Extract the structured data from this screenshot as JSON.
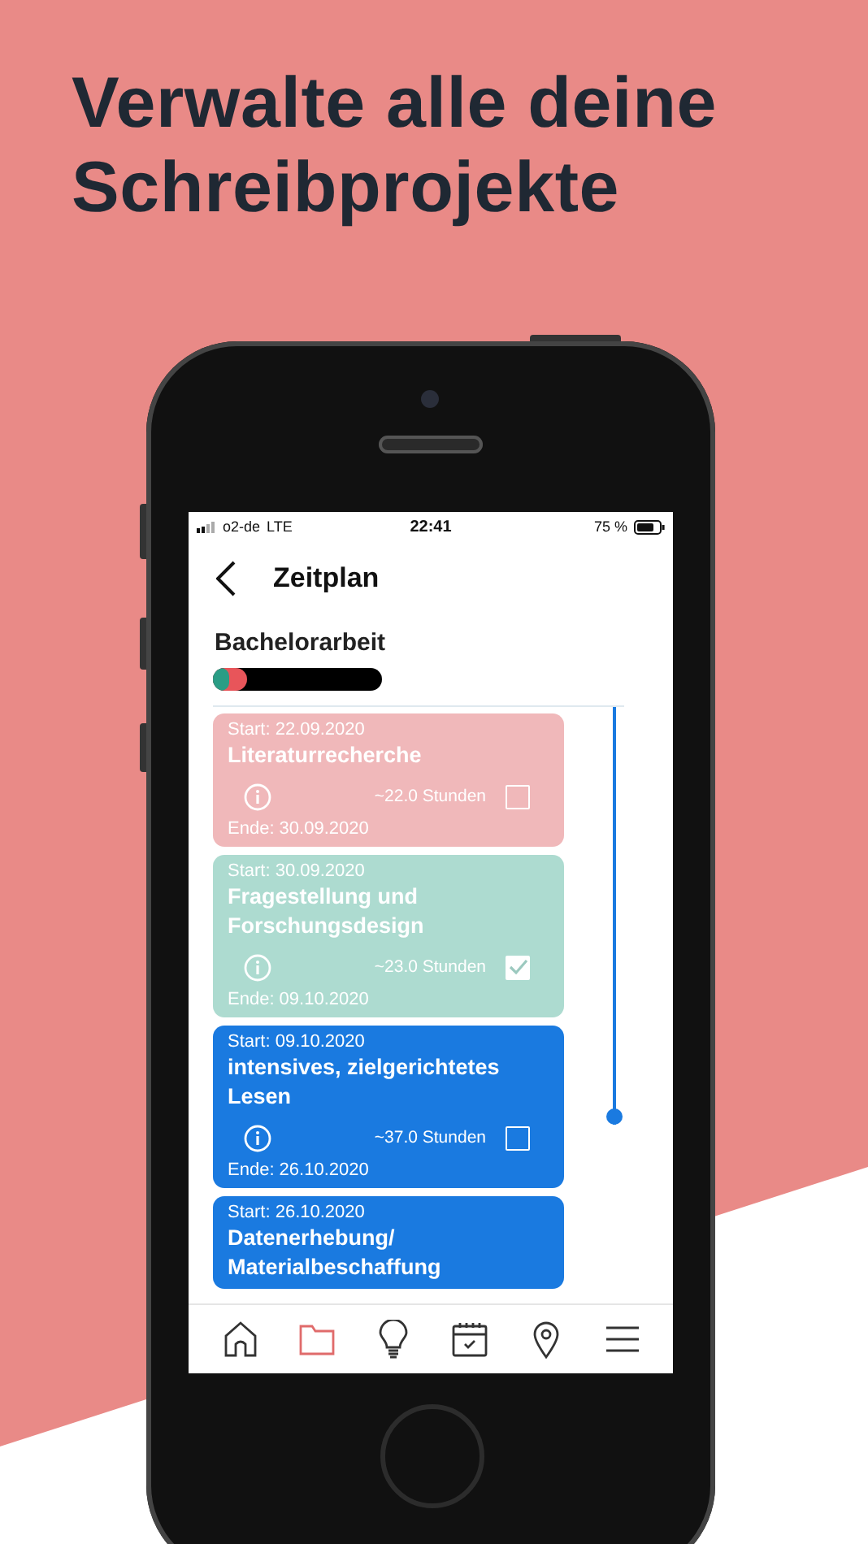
{
  "headline": "Verwalte alle deine Schreibprojekte",
  "status_bar": {
    "carrier": "o2-de",
    "network": "LTE",
    "time": "22:41",
    "battery": "75 %"
  },
  "header": {
    "title": "Zeitplan"
  },
  "project": {
    "name": "Bachelorarbeit",
    "progress": [
      {
        "color": "#e8555a",
        "level": 0.2
      },
      {
        "color": "#2a9d85",
        "level": 0.1
      }
    ]
  },
  "tasks": [
    {
      "start": "Start: 22.09.2020",
      "title": "Literaturrecherche",
      "hours": "~22.0 Stunden",
      "checked": false,
      "end": "Ende: 30.09.2020",
      "color": "#f0b8ba"
    },
    {
      "start": "Start: 30.09.2020",
      "title": "Fragestellung und Forschungsdesign",
      "hours": "~23.0 Stunden",
      "checked": true,
      "end": "Ende: 09.10.2020",
      "color": "#addbd0"
    },
    {
      "start": "Start: 09.10.2020",
      "title": "intensives, zielgerichtetes Lesen",
      "hours": "~37.0 Stunden",
      "checked": false,
      "end": "Ende: 26.10.2020",
      "color": "#1a7ae0"
    },
    {
      "start": "Start: 26.10.2020",
      "title": "Datenerhebung/ Materialbeschaffung",
      "color": "#1a7ae0"
    }
  ],
  "timeline": {
    "level": 1
  },
  "tab_bar": [
    {
      "kind": "home",
      "selected": false
    },
    {
      "kind": "folder",
      "selected": true
    },
    {
      "kind": "bulb",
      "selected": false
    },
    {
      "kind": "calendar",
      "selected": false
    },
    {
      "kind": "pin",
      "selected": false
    },
    {
      "kind": "menu",
      "selected": false
    }
  ]
}
